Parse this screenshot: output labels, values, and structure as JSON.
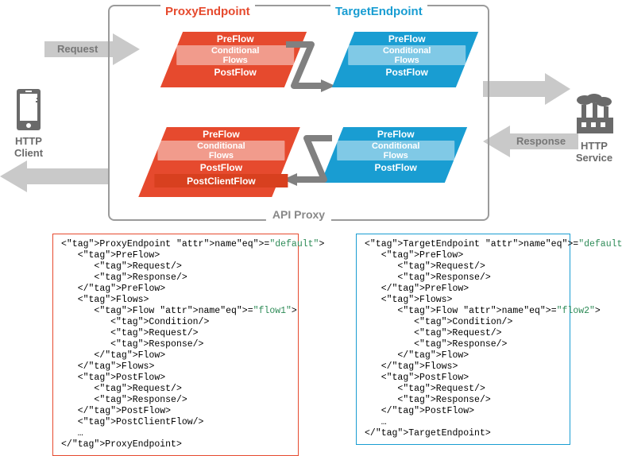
{
  "diagram": {
    "proxy_title": "ProxyEndpoint",
    "target_title": "TargetEndpoint",
    "api_proxy_label": "API Proxy",
    "request_label": "Request",
    "response_label": "Response",
    "client_label": "HTTP\nClient",
    "service_label": "HTTP\nService",
    "stages": {
      "preflow": "PreFlow",
      "conditional": "Conditional\nFlows",
      "postflow": "PostFlow",
      "postclient": "PostClientFlow"
    }
  },
  "code": {
    "proxy": {
      "open": "<ProxyEndpoint name=\"default\">",
      "preflow_open": "<PreFlow>",
      "request": "<Request/>",
      "response": "<Response/>",
      "preflow_close": "</PreFlow>",
      "flows_open": "<Flows>",
      "flow_open": "<Flow name=\"flow1\">",
      "condition": "<Condition/>",
      "flow_close": "</Flow>",
      "flows_close": "</Flows>",
      "postflow_open": "<PostFlow>",
      "postflow_close": "</PostFlow>",
      "postclient": "<PostClientFlow/>",
      "ellipsis": "…",
      "close": "</ProxyEndpoint>"
    },
    "target": {
      "open": "<TargetEndpoint name=\"default\">",
      "preflow_open": "<PreFlow>",
      "request": "<Request/>",
      "response": "<Response/>",
      "preflow_close": "</PreFlow>",
      "flows_open": "<Flows>",
      "flow_open": "<Flow name=\"flow2\">",
      "condition": "<Condition/>",
      "flow_close": "</Flow>",
      "flows_close": "</Flows>",
      "postflow_open": "<PostFlow>",
      "postflow_close": "</PostFlow>",
      "ellipsis": "…",
      "close": "</TargetEndpoint>"
    }
  }
}
